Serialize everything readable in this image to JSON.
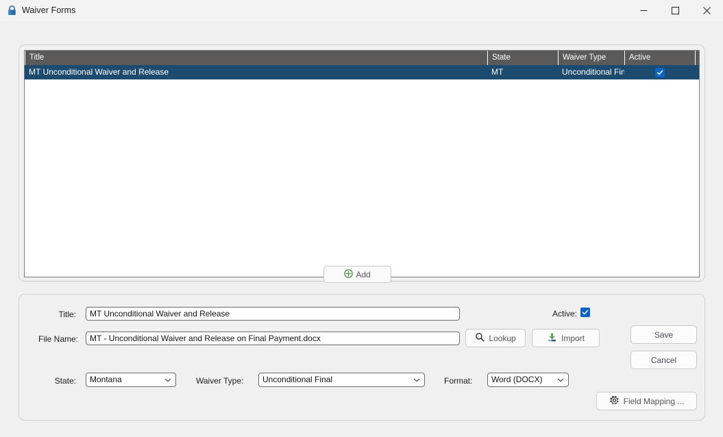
{
  "window": {
    "title": "Waiver Forms",
    "icon": "lock-icon",
    "minimize_label": "–",
    "maximize_label": "□",
    "close_label": "✕"
  },
  "grid": {
    "columns": [
      "Title",
      "State",
      "Waiver Type",
      "Active"
    ],
    "rows": [
      {
        "title": "MT Unconditional Waiver and  Release",
        "state": "MT",
        "waiver_type": "Unconditional Final",
        "active": true
      }
    ],
    "header_bg": "#5a5a5a",
    "selection_bg": "#1d4b70"
  },
  "toolbar": {
    "add_label": "Add",
    "add_icon": "circle-plus-icon"
  },
  "detail": {
    "title_label": "Title:",
    "title_value": "MT Unconditional Waiver and  Release",
    "file_name_label": "File Name:",
    "file_name_value": "MT - Unconditional Waiver and Release on Final Payment.docx",
    "active_label": "Active:",
    "active_checked": true,
    "lookup_label": "Lookup",
    "lookup_icon": "search-icon",
    "import_label": "Import",
    "import_icon": "import-download-icon",
    "save_label": "Save",
    "cancel_label": "Cancel",
    "state_label": "State:",
    "state_value": "Montana",
    "waiver_type_label": "Waiver Type:",
    "waiver_type_value": "Unconditional Final",
    "format_label": "Format:",
    "format_value": "Word (DOCX)",
    "field_mapping_label": "Field Mapping ...",
    "field_mapping_icon": "gear-icon"
  },
  "colors": {
    "accent_blue": "#0c63c4",
    "selection_blue": "#1d4b70",
    "header_gray": "#5a5a5a",
    "green": "#5f9e58"
  }
}
